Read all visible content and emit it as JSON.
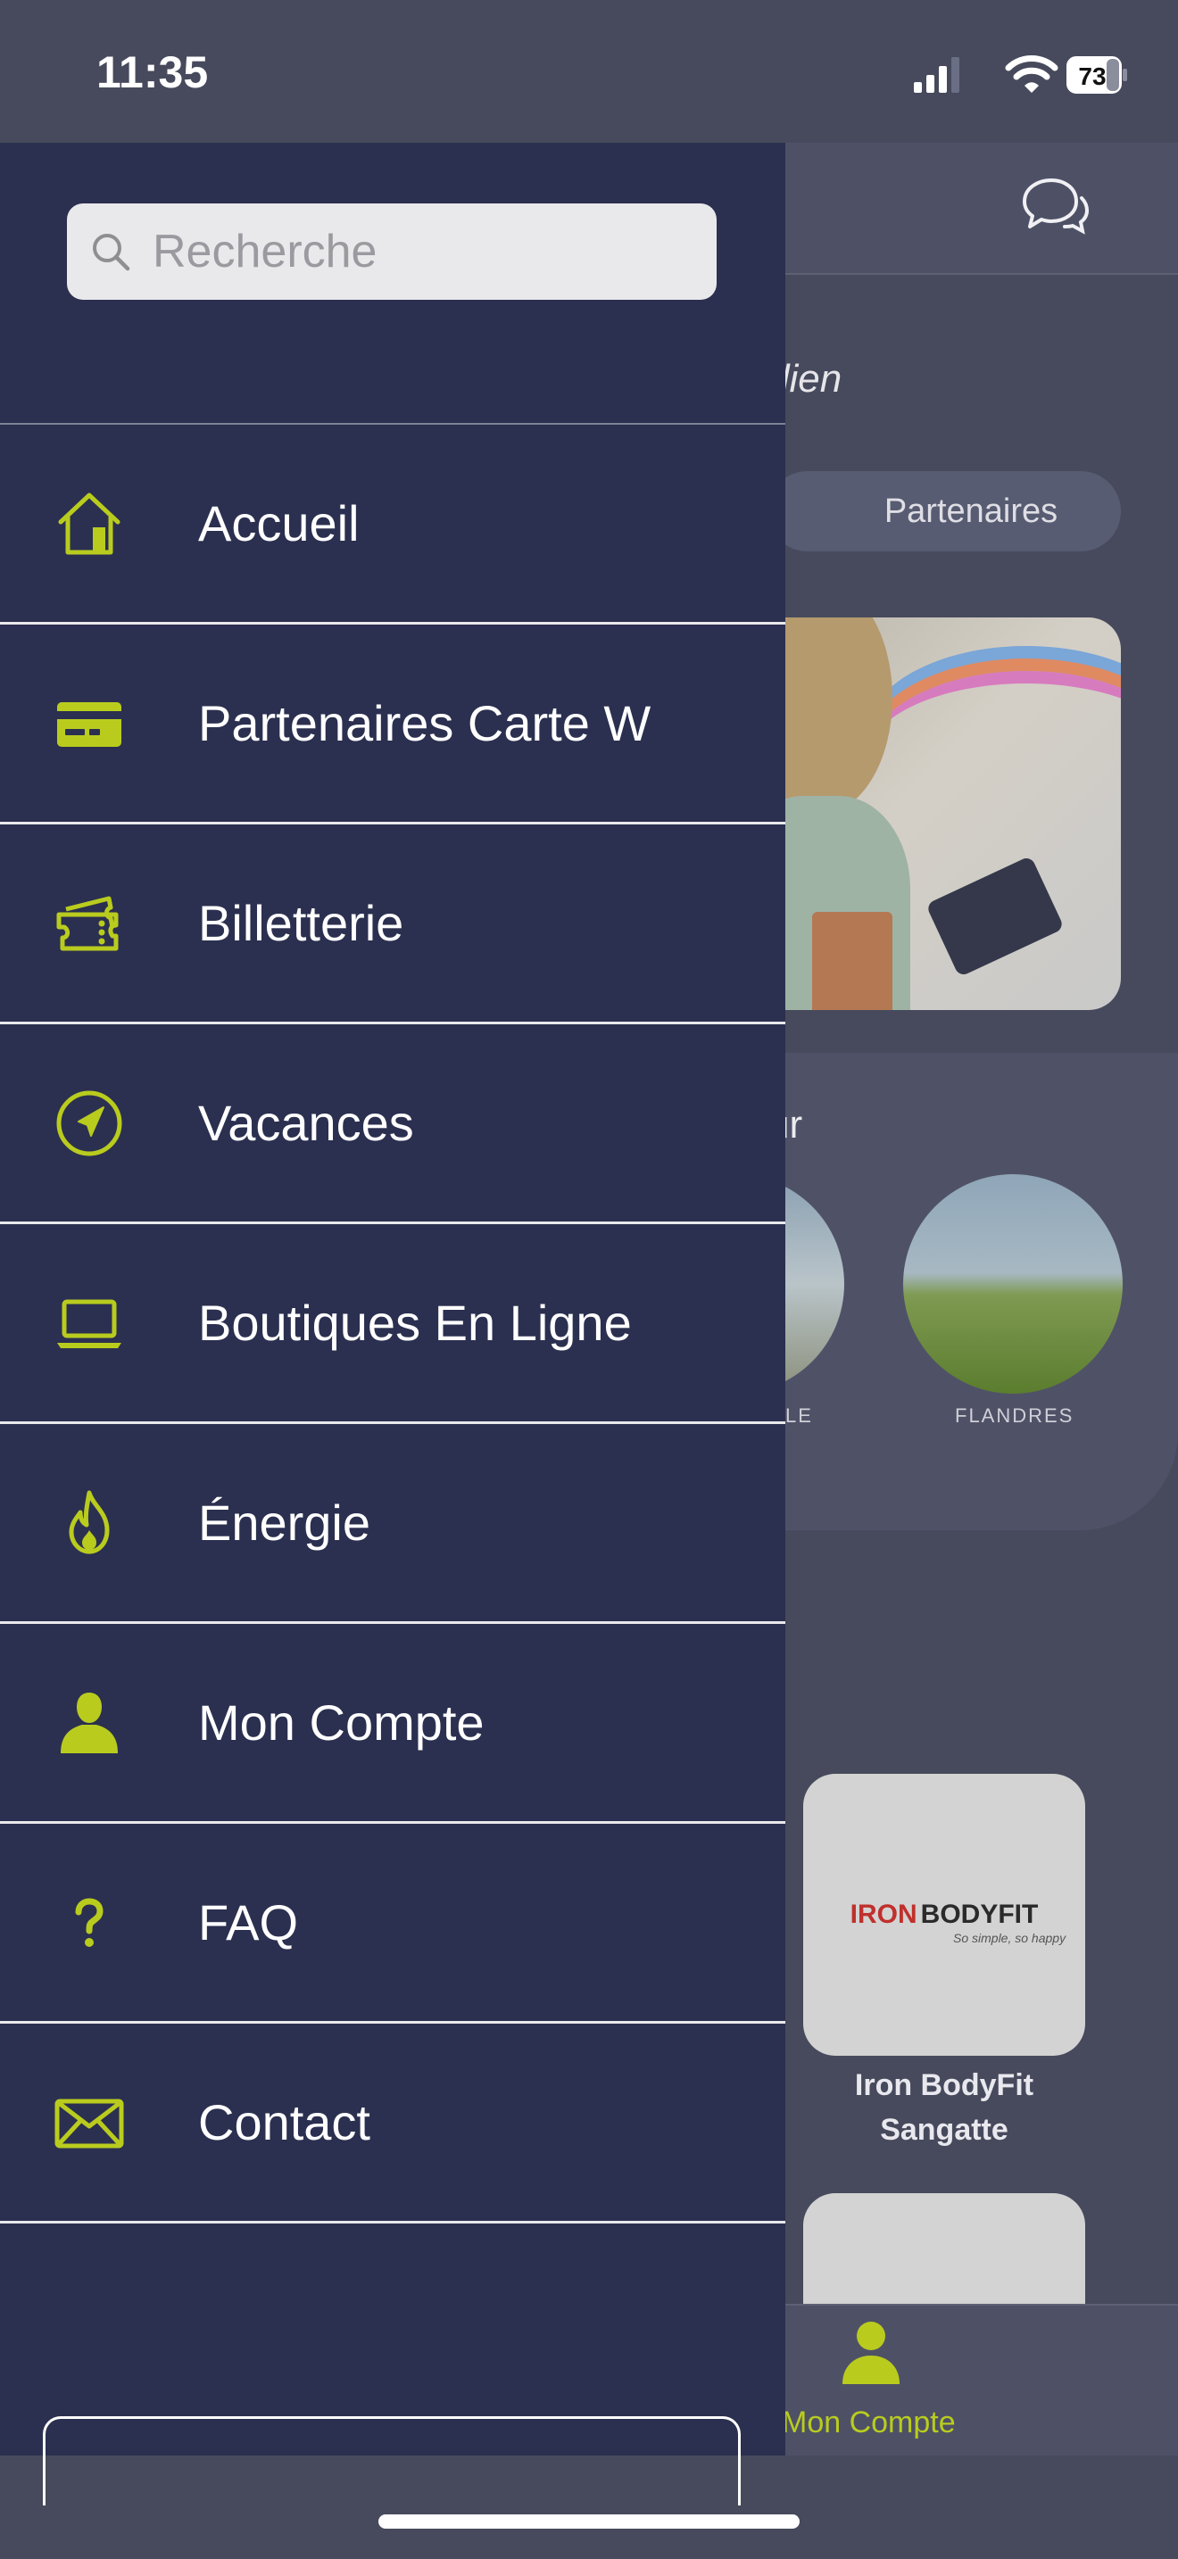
{
  "status_bar": {
    "time": "11:35",
    "battery": "73"
  },
  "search": {
    "placeholder": "Recherche"
  },
  "menu": {
    "items": [
      {
        "label": "Accueil",
        "icon": "home-icon"
      },
      {
        "label": "Partenaires Carte W",
        "icon": "credit-card-icon"
      },
      {
        "label": "Billetterie",
        "icon": "ticket-icon"
      },
      {
        "label": "Vacances",
        "icon": "navigation-arrow-icon"
      },
      {
        "label": "Boutiques En Ligne",
        "icon": "laptop-icon"
      },
      {
        "label": "Énergie",
        "icon": "flame-icon"
      },
      {
        "label": "Mon Compte",
        "icon": "user-icon"
      },
      {
        "label": "FAQ",
        "icon": "question-icon"
      },
      {
        "label": "Contact",
        "icon": "envelope-icon"
      }
    ]
  },
  "background": {
    "subtitle_fragment": "dien",
    "tab_pill": "Partenaires",
    "section_fragment": "ur",
    "circle_labels": [
      "LE",
      "FLANDRES"
    ],
    "partner": {
      "brand_left": "IRON",
      "brand_right": "BODYFIT",
      "tagline": "So simple, so happy",
      "name_line1": "Iron BodyFit",
      "name_line2": "Sangatte"
    },
    "tabbar_label": "Mon Compte"
  },
  "colors": {
    "drawer_bg": "#2b3050",
    "accent": "#b9cc1e",
    "divider": "#e9e9ec"
  }
}
